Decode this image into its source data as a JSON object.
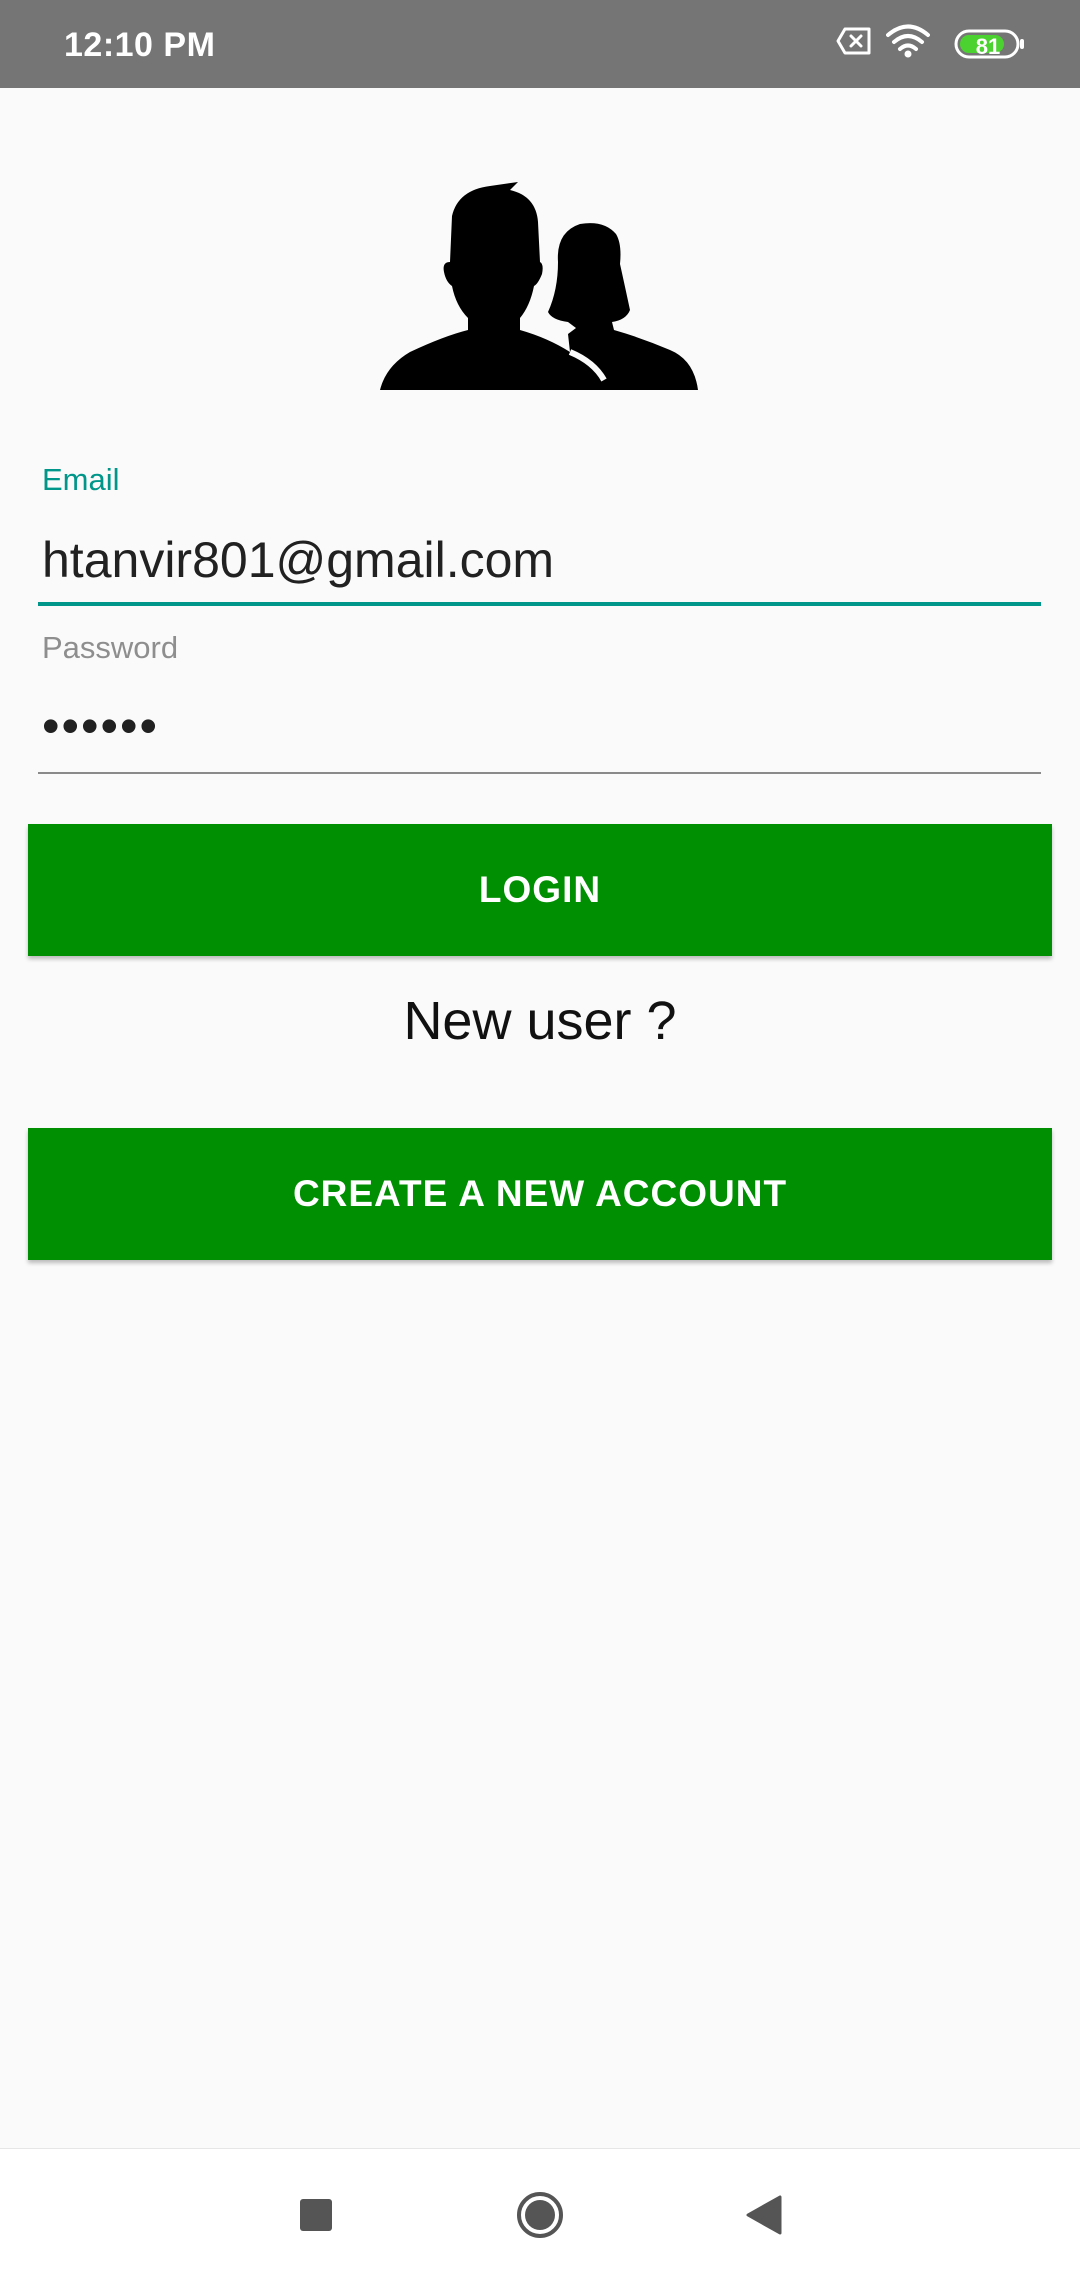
{
  "status_bar": {
    "time": "12:10 PM",
    "battery": "81",
    "icons": [
      "no-sim-icon",
      "wifi-icon",
      "battery-icon"
    ]
  },
  "logo": {
    "icon": "users-icon"
  },
  "form": {
    "email_label": "Email",
    "email_value": "htanvir801@gmail.com",
    "password_label": "Password",
    "password_value": "••••••",
    "accent_color": "#00968a"
  },
  "buttons": {
    "login": "LOGIN",
    "create_account": "CREATE A NEW ACCOUNT",
    "color": "#008f02"
  },
  "prompt": {
    "new_user": "New user ?"
  },
  "nav_bar": {
    "icons": [
      "recents-icon",
      "home-icon",
      "back-icon"
    ]
  }
}
